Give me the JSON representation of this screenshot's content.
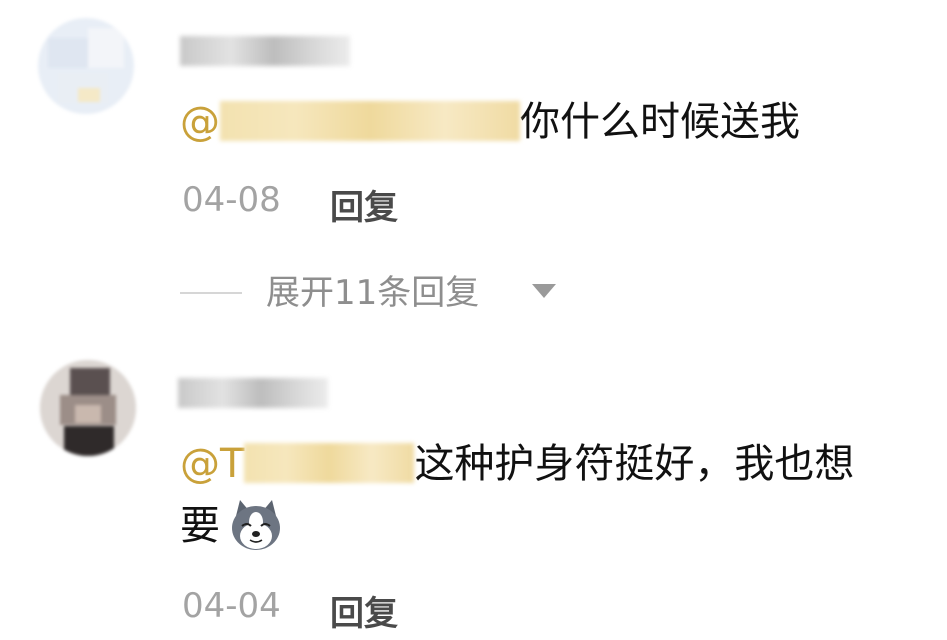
{
  "comments": [
    {
      "mention_prefix": "@",
      "text": "你什么时候送我",
      "date": "04-08",
      "reply_label": "回复"
    },
    {
      "mention_prefix": "@T",
      "text_line1": "这种护身符挺好，我也想",
      "text_line2": "要",
      "emoji": "dog-face-emoji",
      "date": "04-04",
      "reply_label": "回复"
    }
  ],
  "expand_replies": {
    "label": "展开11条回复"
  }
}
